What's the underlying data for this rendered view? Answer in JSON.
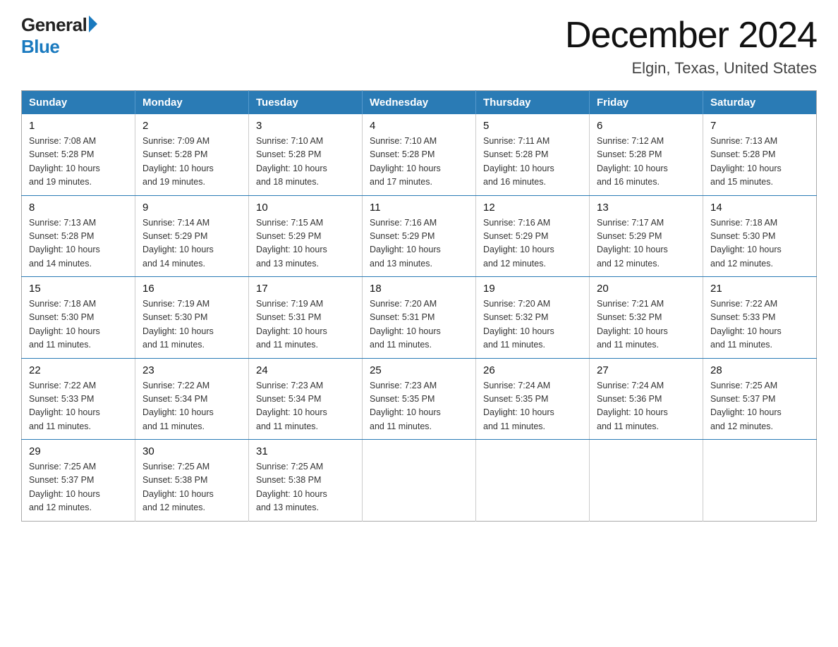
{
  "logo": {
    "general": "General",
    "blue": "Blue"
  },
  "header": {
    "month": "December 2024",
    "location": "Elgin, Texas, United States"
  },
  "weekdays": [
    "Sunday",
    "Monday",
    "Tuesday",
    "Wednesday",
    "Thursday",
    "Friday",
    "Saturday"
  ],
  "weeks": [
    [
      {
        "day": "1",
        "info": "Sunrise: 7:08 AM\nSunset: 5:28 PM\nDaylight: 10 hours\nand 19 minutes."
      },
      {
        "day": "2",
        "info": "Sunrise: 7:09 AM\nSunset: 5:28 PM\nDaylight: 10 hours\nand 19 minutes."
      },
      {
        "day": "3",
        "info": "Sunrise: 7:10 AM\nSunset: 5:28 PM\nDaylight: 10 hours\nand 18 minutes."
      },
      {
        "day": "4",
        "info": "Sunrise: 7:10 AM\nSunset: 5:28 PM\nDaylight: 10 hours\nand 17 minutes."
      },
      {
        "day": "5",
        "info": "Sunrise: 7:11 AM\nSunset: 5:28 PM\nDaylight: 10 hours\nand 16 minutes."
      },
      {
        "day": "6",
        "info": "Sunrise: 7:12 AM\nSunset: 5:28 PM\nDaylight: 10 hours\nand 16 minutes."
      },
      {
        "day": "7",
        "info": "Sunrise: 7:13 AM\nSunset: 5:28 PM\nDaylight: 10 hours\nand 15 minutes."
      }
    ],
    [
      {
        "day": "8",
        "info": "Sunrise: 7:13 AM\nSunset: 5:28 PM\nDaylight: 10 hours\nand 14 minutes."
      },
      {
        "day": "9",
        "info": "Sunrise: 7:14 AM\nSunset: 5:29 PM\nDaylight: 10 hours\nand 14 minutes."
      },
      {
        "day": "10",
        "info": "Sunrise: 7:15 AM\nSunset: 5:29 PM\nDaylight: 10 hours\nand 13 minutes."
      },
      {
        "day": "11",
        "info": "Sunrise: 7:16 AM\nSunset: 5:29 PM\nDaylight: 10 hours\nand 13 minutes."
      },
      {
        "day": "12",
        "info": "Sunrise: 7:16 AM\nSunset: 5:29 PM\nDaylight: 10 hours\nand 12 minutes."
      },
      {
        "day": "13",
        "info": "Sunrise: 7:17 AM\nSunset: 5:29 PM\nDaylight: 10 hours\nand 12 minutes."
      },
      {
        "day": "14",
        "info": "Sunrise: 7:18 AM\nSunset: 5:30 PM\nDaylight: 10 hours\nand 12 minutes."
      }
    ],
    [
      {
        "day": "15",
        "info": "Sunrise: 7:18 AM\nSunset: 5:30 PM\nDaylight: 10 hours\nand 11 minutes."
      },
      {
        "day": "16",
        "info": "Sunrise: 7:19 AM\nSunset: 5:30 PM\nDaylight: 10 hours\nand 11 minutes."
      },
      {
        "day": "17",
        "info": "Sunrise: 7:19 AM\nSunset: 5:31 PM\nDaylight: 10 hours\nand 11 minutes."
      },
      {
        "day": "18",
        "info": "Sunrise: 7:20 AM\nSunset: 5:31 PM\nDaylight: 10 hours\nand 11 minutes."
      },
      {
        "day": "19",
        "info": "Sunrise: 7:20 AM\nSunset: 5:32 PM\nDaylight: 10 hours\nand 11 minutes."
      },
      {
        "day": "20",
        "info": "Sunrise: 7:21 AM\nSunset: 5:32 PM\nDaylight: 10 hours\nand 11 minutes."
      },
      {
        "day": "21",
        "info": "Sunrise: 7:22 AM\nSunset: 5:33 PM\nDaylight: 10 hours\nand 11 minutes."
      }
    ],
    [
      {
        "day": "22",
        "info": "Sunrise: 7:22 AM\nSunset: 5:33 PM\nDaylight: 10 hours\nand 11 minutes."
      },
      {
        "day": "23",
        "info": "Sunrise: 7:22 AM\nSunset: 5:34 PM\nDaylight: 10 hours\nand 11 minutes."
      },
      {
        "day": "24",
        "info": "Sunrise: 7:23 AM\nSunset: 5:34 PM\nDaylight: 10 hours\nand 11 minutes."
      },
      {
        "day": "25",
        "info": "Sunrise: 7:23 AM\nSunset: 5:35 PM\nDaylight: 10 hours\nand 11 minutes."
      },
      {
        "day": "26",
        "info": "Sunrise: 7:24 AM\nSunset: 5:35 PM\nDaylight: 10 hours\nand 11 minutes."
      },
      {
        "day": "27",
        "info": "Sunrise: 7:24 AM\nSunset: 5:36 PM\nDaylight: 10 hours\nand 11 minutes."
      },
      {
        "day": "28",
        "info": "Sunrise: 7:25 AM\nSunset: 5:37 PM\nDaylight: 10 hours\nand 12 minutes."
      }
    ],
    [
      {
        "day": "29",
        "info": "Sunrise: 7:25 AM\nSunset: 5:37 PM\nDaylight: 10 hours\nand 12 minutes."
      },
      {
        "day": "30",
        "info": "Sunrise: 7:25 AM\nSunset: 5:38 PM\nDaylight: 10 hours\nand 12 minutes."
      },
      {
        "day": "31",
        "info": "Sunrise: 7:25 AM\nSunset: 5:38 PM\nDaylight: 10 hours\nand 13 minutes."
      },
      {
        "day": "",
        "info": ""
      },
      {
        "day": "",
        "info": ""
      },
      {
        "day": "",
        "info": ""
      },
      {
        "day": "",
        "info": ""
      }
    ]
  ]
}
